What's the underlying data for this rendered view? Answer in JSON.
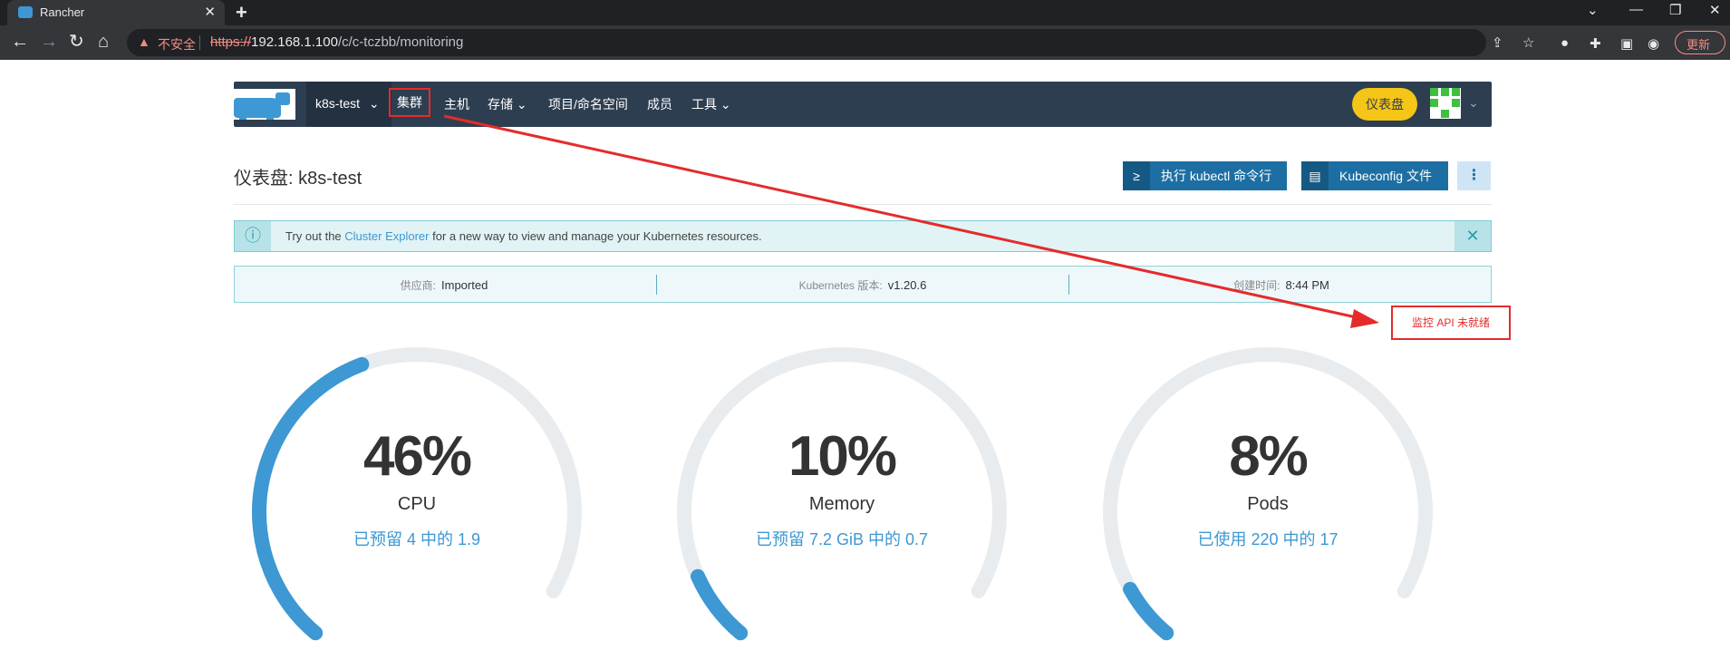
{
  "browser": {
    "tab_title": "Rancher",
    "tab_close": "✕",
    "new_tab": "+",
    "insecure_label": "不安全",
    "url_scheme": "https://",
    "url_host": "192.168.1.100",
    "url_path": "/c/c-tczbb/monitoring",
    "update_label": "更新",
    "win_min": "—",
    "win_restore": "❐",
    "win_close": "✕"
  },
  "nav": {
    "cluster_name": "k8s-test",
    "items": [
      "集群",
      "主机",
      "存储",
      "项目/命名空间",
      "成员",
      "工具"
    ],
    "dashboard_button": "仪表盘"
  },
  "page": {
    "title": "仪表盘: k8s-test",
    "kubectl_button": "执行 kubectl 命令行",
    "kubeconfig_button": "Kubeconfig 文件",
    "more_button": "⋮"
  },
  "banner": {
    "prefix": "Try out the ",
    "link": "Cluster Explorer",
    "suffix": " for a new way to view and manage your Kubernetes resources.",
    "close": "✕",
    "info_icon": "ⓘ"
  },
  "cluster_info": {
    "provider_label": "供应商:",
    "provider_value": "Imported",
    "k8s_label": "Kubernetes 版本:",
    "k8s_value": "v1.20.6",
    "created_label": "创建时间:",
    "created_value": "8:44 PM"
  },
  "annotation": {
    "text": "监控 API 未就绪",
    "color": "#e42b2b"
  },
  "gauges": [
    {
      "percent": "46%",
      "name": "CPU",
      "detail": "已预留 4 中的 1.9",
      "fraction": 0.46
    },
    {
      "percent": "10%",
      "name": "Memory",
      "detail": "已预留 7.2 GiB 中的 0.7",
      "fraction": 0.1
    },
    {
      "percent": "8%",
      "name": "Pods",
      "detail": "已使用 220 中的 17",
      "fraction": 0.08
    }
  ],
  "colors": {
    "accent": "#3d98d3",
    "nav_bg": "#2d3e50",
    "dashboard_btn": "#f5c518",
    "gauge_track": "#e9ecef"
  }
}
